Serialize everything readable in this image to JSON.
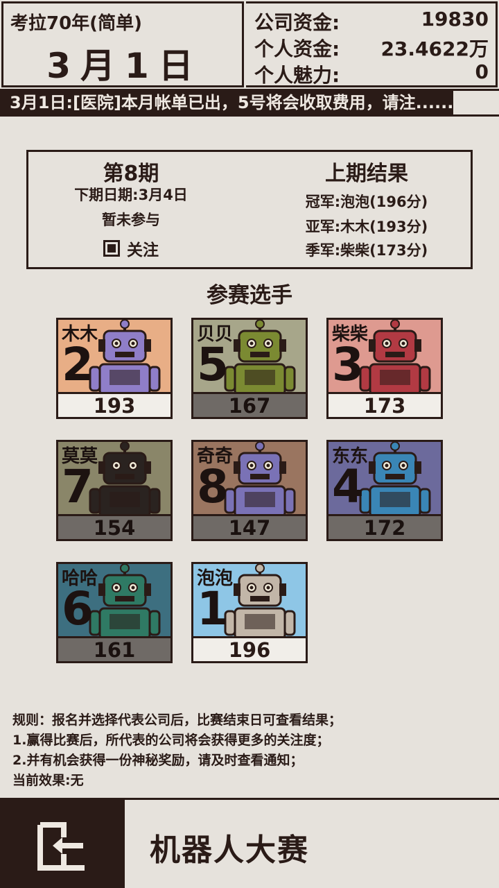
{
  "header": {
    "game_title": "考拉70年(简单)",
    "date": "3月1日",
    "stats": [
      {
        "label": "公司资金:",
        "value": "19830"
      },
      {
        "label": "个人资金:",
        "value": "23.4622万"
      },
      {
        "label": "个人魅力:",
        "value": "0"
      }
    ]
  },
  "ticker": {
    "text": "3月1日:[医院]本月帐单已出，5号将会收取费用，请注......"
  },
  "panel": {
    "period_title": "第8期",
    "next_date": "下期日期:3月4日",
    "participation": "暂未参与",
    "follow_label": "关注",
    "follow_checked": true,
    "last_title": "上期结果",
    "champion": "冠军:泡泡(196分)",
    "runner_up": "亚军:木木(193分)",
    "third": "季军:柴柴(173分)"
  },
  "section_title": "参赛选手",
  "robots": [
    {
      "name": "木木",
      "number": "2",
      "score": "193",
      "bg": "#e8ae86",
      "body": "#8f7ec8",
      "style": "light"
    },
    {
      "name": "贝贝",
      "number": "5",
      "score": "167",
      "bg": "#a7a68a",
      "body": "#7b8a32",
      "style": "dark"
    },
    {
      "name": "柴柴",
      "number": "3",
      "score": "173",
      "bg": "#de9a90",
      "body": "#b23a43",
      "style": "light"
    },
    {
      "name": "莫莫",
      "number": "7",
      "score": "154",
      "bg": "#8a8669",
      "body": "#2a2320",
      "style": "dark"
    },
    {
      "name": "奇奇",
      "number": "8",
      "score": "147",
      "bg": "#9a7560",
      "body": "#7a72b6",
      "style": "dark"
    },
    {
      "name": "东东",
      "number": "4",
      "score": "172",
      "bg": "#6c6a9c",
      "body": "#3a86b6",
      "style": "dark"
    },
    {
      "name": "哈哈",
      "number": "6",
      "score": "161",
      "bg": "#3d6f80",
      "body": "#2f7a64",
      "style": "dark"
    },
    {
      "name": "泡泡",
      "number": "1",
      "score": "196",
      "bg": "#8ec6e6",
      "body": "#c2b6a8",
      "style": "light"
    }
  ],
  "rules": [
    "规则：报名并选择代表公司后，比赛结束日可查看结果；",
    "1.赢得比赛后，所代表的公司将会获得更多的关注度；",
    "2.并有机会获得一份神秘奖励，请及时查看通知；",
    "当前效果:无"
  ],
  "footer": {
    "title": "机器人大赛",
    "exit_icon": "exit-door-icon"
  }
}
